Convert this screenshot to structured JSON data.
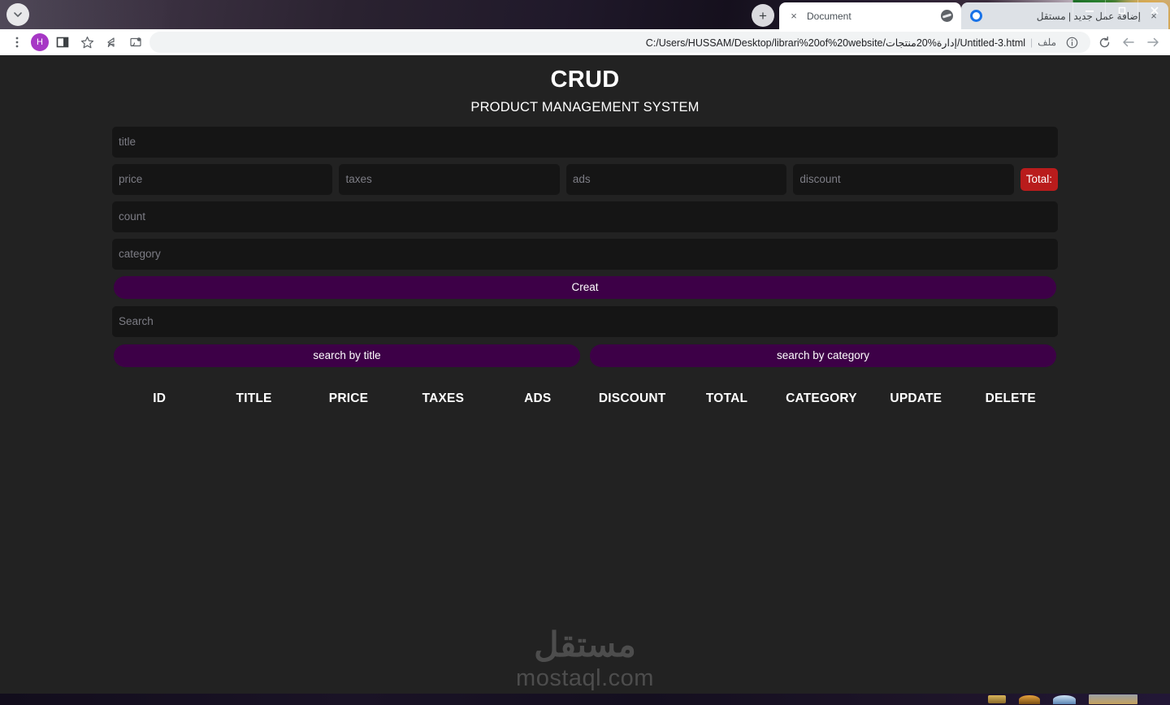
{
  "browser": {
    "tab_search_icon": "chevron-down-icon",
    "new_tab_label": "+",
    "tabs": [
      {
        "title": "Document",
        "favicon": "globe-icon",
        "close_label": "×",
        "active": true
      },
      {
        "title": "إضافة عمل جديد | مستقل",
        "favicon": "ring-icon",
        "close_label": "×",
        "active": false
      }
    ],
    "window_controls": {
      "minimize": "minimize-icon",
      "restore": "restore-icon",
      "close": "close-icon"
    },
    "toolbar": {
      "menu_icon": "three-dot-menu-icon",
      "profile_initial": "H",
      "sidebar_icon": "side-panel-icon",
      "bookmark_icon": "star-icon",
      "share_icon": "share-icon",
      "cast_icon": "cast-icon",
      "reload_icon": "reload-icon",
      "back_icon": "back-arrow-icon",
      "forward_icon": "forward-arrow-icon",
      "info_icon": "page-info-icon"
    },
    "omnibox": {
      "url": "C:/Users/HUSSAM/Desktop/librari%20of%20website/إدارة%20منتجات/Untitled-3.html",
      "file_label": "ملف",
      "separator": "|"
    }
  },
  "page": {
    "title": "CRUD",
    "subtitle": "PRODUCT MANAGEMENT SYSTEM",
    "colors": {
      "background": "#222222",
      "field": "#151515",
      "accent_purple": "#3d0047",
      "total_red": "#b91c1c",
      "text": "#ffffff"
    },
    "form": {
      "title_placeholder": "title",
      "price_placeholder": "price",
      "taxes_placeholder": "taxes",
      "ads_placeholder": "ads",
      "discount_placeholder": "discount",
      "total_label": "Total:",
      "count_placeholder": "count",
      "category_placeholder": "category",
      "create_label": "Creat",
      "values": {
        "title": "",
        "price": "",
        "taxes": "",
        "ads": "",
        "discount": "",
        "count": "",
        "category": ""
      }
    },
    "search": {
      "placeholder": "Search",
      "value": "",
      "by_title_label": "search by title",
      "by_category_label": "search by category"
    },
    "table": {
      "headers": [
        "ID",
        "TITLE",
        "PRICE",
        "TAXES",
        "ADS",
        "DISCOUNT",
        "TOTAL",
        "CATEGORY",
        "UPDATE",
        "DELETE"
      ],
      "rows": []
    },
    "watermark": {
      "arabic": "مستقل",
      "latin": "mostaql.com"
    }
  }
}
